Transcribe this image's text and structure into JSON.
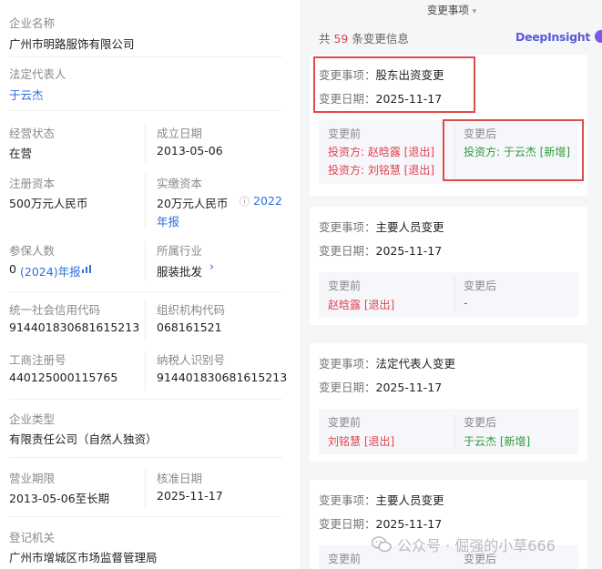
{
  "company": {
    "name_label": "企业名称",
    "name_value": "广州市明路服饰有限公司",
    "legal_label": "法定代表人",
    "legal_value": "于云杰",
    "status_label": "经营状态",
    "status_value": "在营",
    "founded_label": "成立日期",
    "founded_value": "2013-05-06",
    "reg_capital_label": "注册资本",
    "reg_capital_value": "500万元人民币",
    "paid_capital_label": "实缴资本",
    "paid_capital_value": "20万元人民币",
    "paid_capital_report_year": "2022",
    "paid_capital_report_suffix": "年报",
    "insured_label": "参保人数",
    "insured_value": "0",
    "insured_report": "(2024)年报",
    "industry_label": "所属行业",
    "industry_value": "服装批发",
    "credit_code_label": "统一社会信用代码",
    "credit_code_value": "914401830681615213",
    "org_code_label": "组织机构代码",
    "org_code_value": "068161521",
    "biz_reg_label": "工商注册号",
    "biz_reg_value": "440125000115765",
    "taxpayer_label": "纳税人识别号",
    "taxpayer_value": "914401830681615213",
    "type_label": "企业类型",
    "type_value": "有限责任公司（自然人独资）",
    "term_label": "营业期限",
    "term_value": "2013-05-06至长期",
    "approval_label": "核准日期",
    "approval_value": "2025-11-17",
    "authority_label": "登记机关",
    "authority_value": "广州市增城区市场监督管理局"
  },
  "changes": {
    "header": "变更事项",
    "header_arrow": "▾",
    "count_prefix": "共 ",
    "count_value": "59",
    "count_suffix": " 条变更信息",
    "brand": "DeepInsight",
    "item_key": "变更事项：",
    "date_key": "变更日期：",
    "before_label": "变更前",
    "after_label": "变更后",
    "items": [
      {
        "item": "股东出资变更",
        "date": "2025-11-17",
        "before": [
          "投资方: 赵晗露 [退出]",
          "投资方: 刘铭慧 [退出]"
        ],
        "after": [
          "投资方: 于云杰 [新增]"
        ]
      },
      {
        "item": "主要人员变更",
        "date": "2025-11-17",
        "before": [
          "赵晗露 [退出]"
        ],
        "after": [
          "-"
        ]
      },
      {
        "item": "法定代表人变更",
        "date": "2025-11-17",
        "before": [
          "刘铭慧 [退出]"
        ],
        "after": [
          "于云杰 [新增]"
        ]
      },
      {
        "item": "主要人员变更",
        "date": "2025-11-17",
        "before": [],
        "after": []
      }
    ]
  },
  "watermark": "公众号 · 倔强的小草666"
}
